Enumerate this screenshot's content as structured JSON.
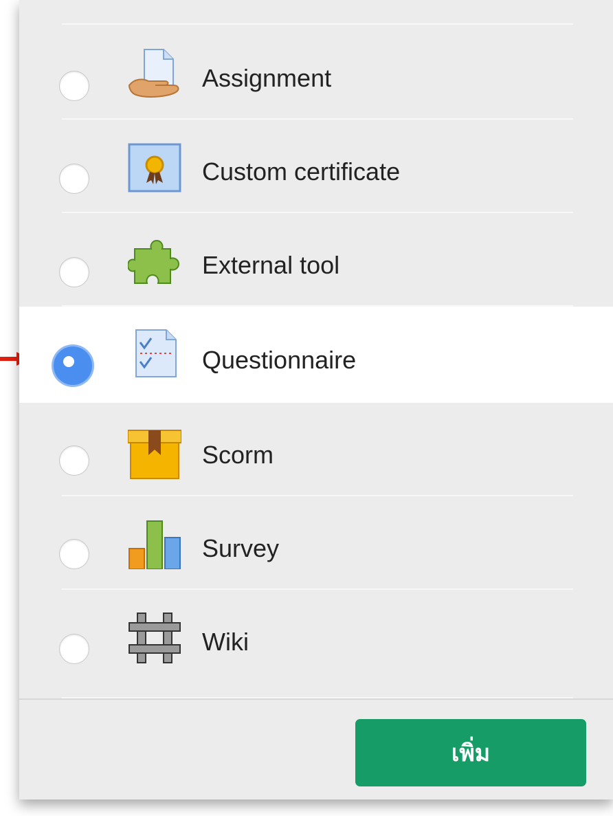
{
  "activities": [
    {
      "label": "Assignment",
      "icon": "assignment-icon",
      "selected": false
    },
    {
      "label": "Custom certificate",
      "icon": "certificate-icon",
      "selected": false
    },
    {
      "label": "External tool",
      "icon": "puzzle-icon",
      "selected": false
    },
    {
      "label": "Questionnaire",
      "icon": "questionnaire-icon",
      "selected": true
    },
    {
      "label": "Scorm",
      "icon": "scorm-package-icon",
      "selected": false
    },
    {
      "label": "Survey",
      "icon": "survey-chart-icon",
      "selected": false
    },
    {
      "label": "Wiki",
      "icon": "wiki-icon",
      "selected": false
    }
  ],
  "footer": {
    "add_label": "เพิ่ม"
  },
  "colors": {
    "accent": "#169c67",
    "selected_radio": "#4a8ff0",
    "pointer_arrow": "#e02010"
  }
}
